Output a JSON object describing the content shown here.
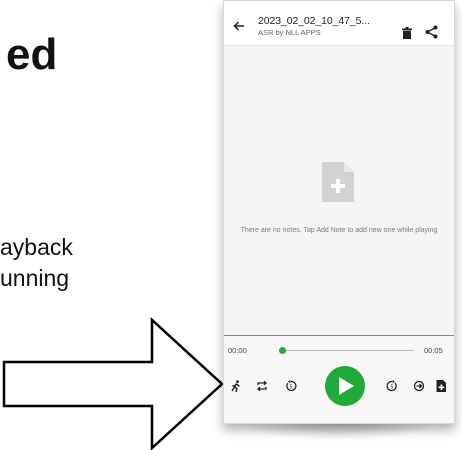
{
  "slide": {
    "heading_fragment": "ed",
    "text_line_1": "ayback",
    "text_line_2": "unning"
  },
  "app": {
    "title": "2023_02_02_10_47_5...",
    "subtitle": "ASR by NLL APPS",
    "empty_message": "There are no notes. Tap Add Note to add new one while playing",
    "time_start": "00:00",
    "time_end": "00:05",
    "progress_fraction": 0.0
  },
  "colors": {
    "accent_green": "#1faa3a",
    "arrow_outline": "#000000",
    "arrow_fill": "#ffffff"
  },
  "icons": {
    "back": "arrow-left",
    "delete": "trash",
    "share": "share",
    "note_add": "note-add",
    "speed": "running-person",
    "loop": "repeat",
    "rewind": "replay-5",
    "play": "play",
    "forward": "forward-5",
    "skip_silence": "skip",
    "add_note": "note-add-small"
  }
}
